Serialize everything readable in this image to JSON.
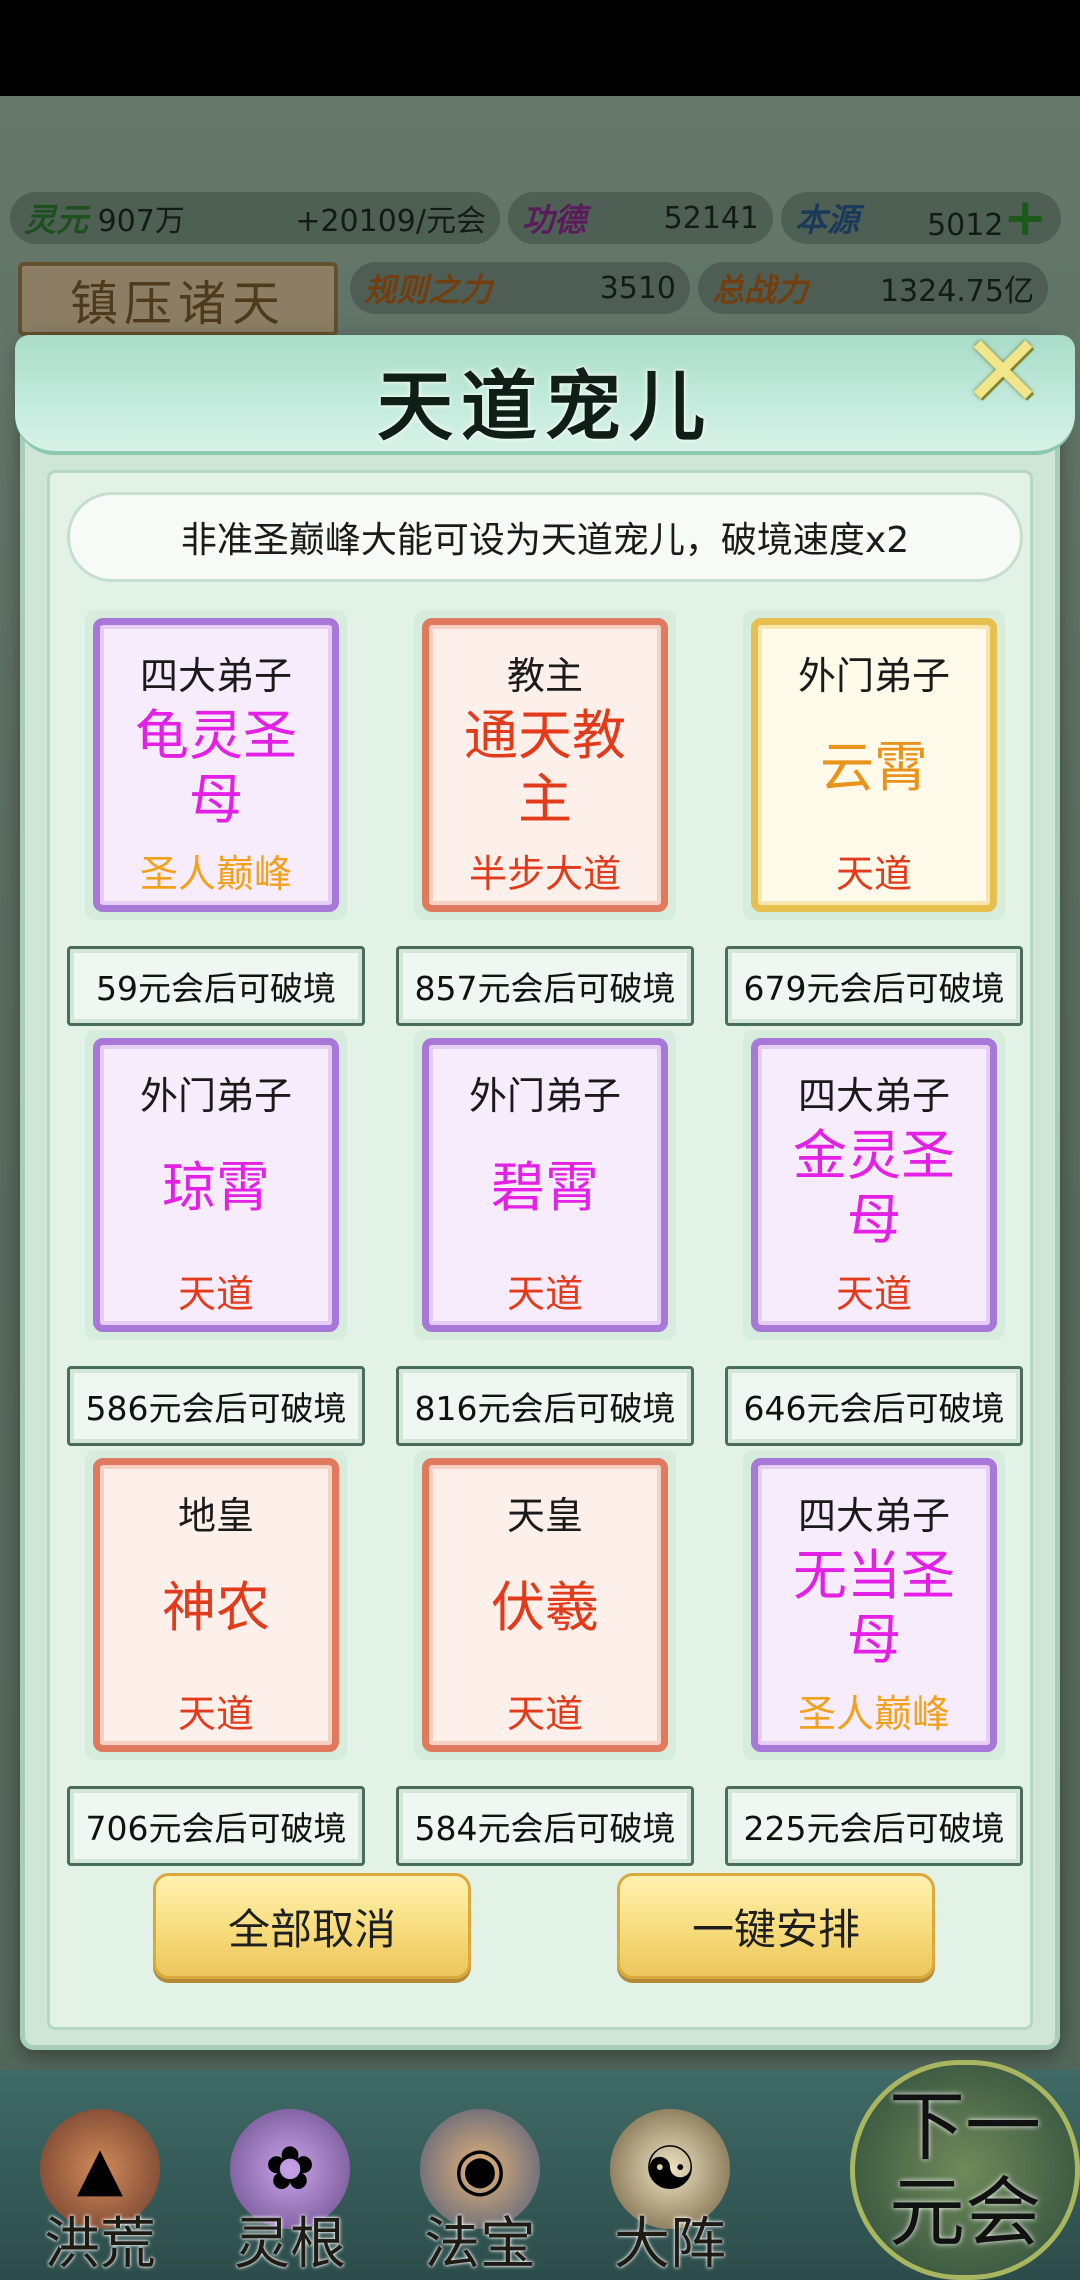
{
  "resources": {
    "lingyuan": {
      "label": "灵元",
      "value": "907万",
      "rate": "+20109/元会"
    },
    "gongde": {
      "label": "功德",
      "value": "52141"
    },
    "benyuan": {
      "label": "本源",
      "value": "5012"
    },
    "guize": {
      "label": "规则之力",
      "value": "3510"
    },
    "zhanli": {
      "label": "总战力",
      "value": "1324.75亿"
    }
  },
  "banner_label": "镇压诸天",
  "dialog": {
    "title": "天道宠儿",
    "notice": "非准圣巅峰大能可设为天道宠儿，破境速度x2",
    "cards": [
      {
        "title": "四大弟子",
        "name": "龟灵圣母",
        "level": "圣人巅峰",
        "time": "59元会后可破境"
      },
      {
        "title": "教主",
        "name": "通天教主",
        "level": "半步大道",
        "time": "857元会后可破境"
      },
      {
        "title": "外门弟子",
        "name": "云霄",
        "level": "天道",
        "time": "679元会后可破境"
      },
      {
        "title": "外门弟子",
        "name": "琼霄",
        "level": "天道",
        "time": "586元会后可破境"
      },
      {
        "title": "外门弟子",
        "name": "碧霄",
        "level": "天道",
        "time": "816元会后可破境"
      },
      {
        "title": "四大弟子",
        "name": "金灵圣母",
        "level": "天道",
        "time": "646元会后可破境"
      },
      {
        "title": "地皇",
        "name": "神农",
        "level": "天道",
        "time": "706元会后可破境"
      },
      {
        "title": "天皇",
        "name": "伏羲",
        "level": "天道",
        "time": "584元会后可破境"
      },
      {
        "title": "四大弟子",
        "name": "无当圣母",
        "level": "圣人巅峰",
        "time": "225元会后可破境"
      }
    ],
    "cancel_all_label": "全部取消",
    "auto_arrange_label": "一键安排"
  },
  "bottom_nav": {
    "items": [
      "洪荒",
      "灵根",
      "法宝",
      "大阵"
    ],
    "next_label_line1": "下一",
    "next_label_line2": "元会"
  },
  "colors": {
    "purple_frame": "#a878d8",
    "red_frame": "#e07a5e",
    "gold_frame": "#e6bf4f",
    "magenta_name": "#e41fe6",
    "red_name": "#e23b1c",
    "orange_name": "#e8931c",
    "gold_level": "#f0a21e"
  }
}
